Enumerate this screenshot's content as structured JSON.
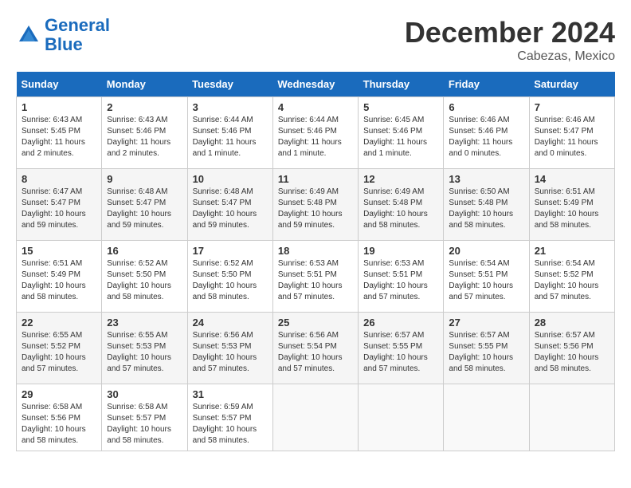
{
  "header": {
    "logo_line1": "General",
    "logo_line2": "Blue",
    "month": "December 2024",
    "location": "Cabezas, Mexico"
  },
  "weekdays": [
    "Sunday",
    "Monday",
    "Tuesday",
    "Wednesday",
    "Thursday",
    "Friday",
    "Saturday"
  ],
  "weeks": [
    [
      {
        "day": "1",
        "sunrise": "6:43 AM",
        "sunset": "5:45 PM",
        "daylight": "11 hours and 2 minutes."
      },
      {
        "day": "2",
        "sunrise": "6:43 AM",
        "sunset": "5:46 PM",
        "daylight": "11 hours and 2 minutes."
      },
      {
        "day": "3",
        "sunrise": "6:44 AM",
        "sunset": "5:46 PM",
        "daylight": "11 hours and 1 minute."
      },
      {
        "day": "4",
        "sunrise": "6:44 AM",
        "sunset": "5:46 PM",
        "daylight": "11 hours and 1 minute."
      },
      {
        "day": "5",
        "sunrise": "6:45 AM",
        "sunset": "5:46 PM",
        "daylight": "11 hours and 1 minute."
      },
      {
        "day": "6",
        "sunrise": "6:46 AM",
        "sunset": "5:46 PM",
        "daylight": "11 hours and 0 minutes."
      },
      {
        "day": "7",
        "sunrise": "6:46 AM",
        "sunset": "5:47 PM",
        "daylight": "11 hours and 0 minutes."
      }
    ],
    [
      {
        "day": "8",
        "sunrise": "6:47 AM",
        "sunset": "5:47 PM",
        "daylight": "10 hours and 59 minutes."
      },
      {
        "day": "9",
        "sunrise": "6:48 AM",
        "sunset": "5:47 PM",
        "daylight": "10 hours and 59 minutes."
      },
      {
        "day": "10",
        "sunrise": "6:48 AM",
        "sunset": "5:47 PM",
        "daylight": "10 hours and 59 minutes."
      },
      {
        "day": "11",
        "sunrise": "6:49 AM",
        "sunset": "5:48 PM",
        "daylight": "10 hours and 59 minutes."
      },
      {
        "day": "12",
        "sunrise": "6:49 AM",
        "sunset": "5:48 PM",
        "daylight": "10 hours and 58 minutes."
      },
      {
        "day": "13",
        "sunrise": "6:50 AM",
        "sunset": "5:48 PM",
        "daylight": "10 hours and 58 minutes."
      },
      {
        "day": "14",
        "sunrise": "6:51 AM",
        "sunset": "5:49 PM",
        "daylight": "10 hours and 58 minutes."
      }
    ],
    [
      {
        "day": "15",
        "sunrise": "6:51 AM",
        "sunset": "5:49 PM",
        "daylight": "10 hours and 58 minutes."
      },
      {
        "day": "16",
        "sunrise": "6:52 AM",
        "sunset": "5:50 PM",
        "daylight": "10 hours and 58 minutes."
      },
      {
        "day": "17",
        "sunrise": "6:52 AM",
        "sunset": "5:50 PM",
        "daylight": "10 hours and 58 minutes."
      },
      {
        "day": "18",
        "sunrise": "6:53 AM",
        "sunset": "5:51 PM",
        "daylight": "10 hours and 57 minutes."
      },
      {
        "day": "19",
        "sunrise": "6:53 AM",
        "sunset": "5:51 PM",
        "daylight": "10 hours and 57 minutes."
      },
      {
        "day": "20",
        "sunrise": "6:54 AM",
        "sunset": "5:51 PM",
        "daylight": "10 hours and 57 minutes."
      },
      {
        "day": "21",
        "sunrise": "6:54 AM",
        "sunset": "5:52 PM",
        "daylight": "10 hours and 57 minutes."
      }
    ],
    [
      {
        "day": "22",
        "sunrise": "6:55 AM",
        "sunset": "5:52 PM",
        "daylight": "10 hours and 57 minutes."
      },
      {
        "day": "23",
        "sunrise": "6:55 AM",
        "sunset": "5:53 PM",
        "daylight": "10 hours and 57 minutes."
      },
      {
        "day": "24",
        "sunrise": "6:56 AM",
        "sunset": "5:53 PM",
        "daylight": "10 hours and 57 minutes."
      },
      {
        "day": "25",
        "sunrise": "6:56 AM",
        "sunset": "5:54 PM",
        "daylight": "10 hours and 57 minutes."
      },
      {
        "day": "26",
        "sunrise": "6:57 AM",
        "sunset": "5:55 PM",
        "daylight": "10 hours and 57 minutes."
      },
      {
        "day": "27",
        "sunrise": "6:57 AM",
        "sunset": "5:55 PM",
        "daylight": "10 hours and 58 minutes."
      },
      {
        "day": "28",
        "sunrise": "6:57 AM",
        "sunset": "5:56 PM",
        "daylight": "10 hours and 58 minutes."
      }
    ],
    [
      {
        "day": "29",
        "sunrise": "6:58 AM",
        "sunset": "5:56 PM",
        "daylight": "10 hours and 58 minutes."
      },
      {
        "day": "30",
        "sunrise": "6:58 AM",
        "sunset": "5:57 PM",
        "daylight": "10 hours and 58 minutes."
      },
      {
        "day": "31",
        "sunrise": "6:59 AM",
        "sunset": "5:57 PM",
        "daylight": "10 hours and 58 minutes."
      },
      null,
      null,
      null,
      null
    ]
  ]
}
